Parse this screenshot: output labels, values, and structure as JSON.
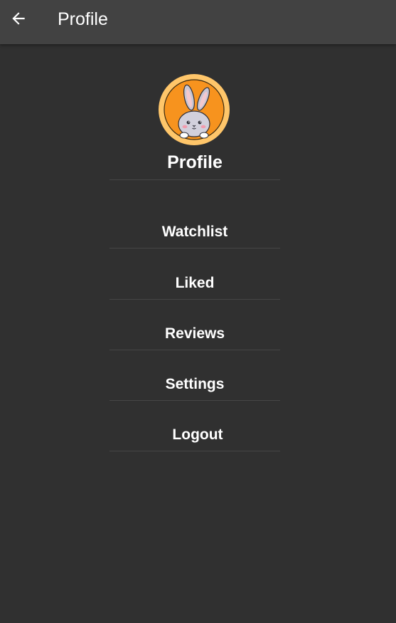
{
  "app_bar": {
    "title": "Profile",
    "back_icon": "arrow-left-icon"
  },
  "profile": {
    "avatar_icon": "bunny-avatar-icon",
    "name": "Profile"
  },
  "menu": {
    "items": [
      {
        "label": "Watchlist"
      },
      {
        "label": "Liked"
      },
      {
        "label": "Reviews"
      },
      {
        "label": "Settings"
      },
      {
        "label": "Logout"
      }
    ]
  },
  "colors": {
    "background": "#303030",
    "app_bar": "#424242",
    "avatar_ring": "#FFC66A",
    "avatar_fill": "#F7931E"
  }
}
